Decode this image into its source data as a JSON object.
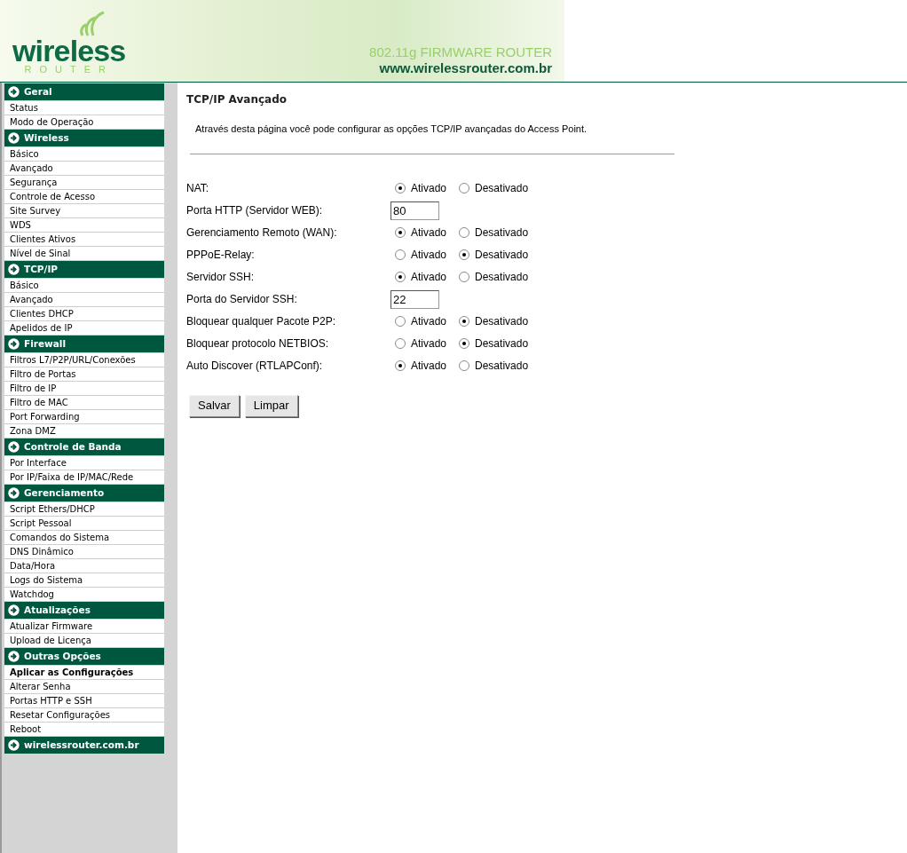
{
  "header": {
    "logo_word": "wireless",
    "logo_sub": "ROUTER",
    "tagline": "802.11g FIRMWARE ROUTER",
    "url": "www.wirelessrouter.com.br"
  },
  "sidebar": {
    "sections": [
      {
        "title": "Geral",
        "items": [
          {
            "label": "Status",
            "bold": false
          },
          {
            "label": "Modo de Operação",
            "bold": false
          }
        ]
      },
      {
        "title": "Wireless",
        "items": [
          {
            "label": "Básico",
            "bold": false
          },
          {
            "label": "Avançado",
            "bold": false
          },
          {
            "label": "Segurança",
            "bold": false
          },
          {
            "label": "Controle de Acesso",
            "bold": false
          },
          {
            "label": "Site Survey",
            "bold": false
          },
          {
            "label": "WDS",
            "bold": false
          },
          {
            "label": "Clientes Ativos",
            "bold": false
          },
          {
            "label": "Nível de Sinal",
            "bold": false
          }
        ]
      },
      {
        "title": "TCP/IP",
        "items": [
          {
            "label": "Básico",
            "bold": false
          },
          {
            "label": "Avançado",
            "bold": false
          },
          {
            "label": "Clientes DHCP",
            "bold": false
          },
          {
            "label": "Apelidos de IP",
            "bold": false
          }
        ]
      },
      {
        "title": "Firewall",
        "items": [
          {
            "label": "Filtros L7/P2P/URL/Conexões",
            "bold": false
          },
          {
            "label": "Filtro de Portas",
            "bold": false
          },
          {
            "label": "Filtro de IP",
            "bold": false
          },
          {
            "label": "Filtro de MAC",
            "bold": false
          },
          {
            "label": "Port Forwarding",
            "bold": false
          },
          {
            "label": "Zona DMZ",
            "bold": false
          }
        ]
      },
      {
        "title": "Controle de Banda",
        "items": [
          {
            "label": "Por Interface",
            "bold": false
          },
          {
            "label": "Por IP/Faixa de IP/MAC/Rede",
            "bold": false
          }
        ]
      },
      {
        "title": "Gerenciamento",
        "items": [
          {
            "label": "Script Ethers/DHCP",
            "bold": false
          },
          {
            "label": "Script Pessoal",
            "bold": false
          },
          {
            "label": "Comandos do Sistema",
            "bold": false
          },
          {
            "label": "DNS Dinâmico",
            "bold": false
          },
          {
            "label": "Data/Hora",
            "bold": false
          },
          {
            "label": "Logs do Sistema",
            "bold": false
          },
          {
            "label": "Watchdog",
            "bold": false
          }
        ]
      },
      {
        "title": "Atualizações",
        "items": [
          {
            "label": "Atualizar Firmware",
            "bold": false
          },
          {
            "label": "Upload de Licença",
            "bold": false
          }
        ]
      },
      {
        "title": "Outras Opções",
        "items": [
          {
            "label": "Aplicar as Configurações",
            "bold": true
          },
          {
            "label": "Alterar Senha",
            "bold": false
          },
          {
            "label": "Portas HTTP e SSH",
            "bold": false
          },
          {
            "label": "Resetar Configurações",
            "bold": false
          },
          {
            "label": "Reboot",
            "bold": false
          }
        ]
      },
      {
        "title": "wirelessrouter.com.br"
      }
    ]
  },
  "page": {
    "title": "TCP/IP Avançado",
    "description": "Através desta página você pode configurar as opções TCP/IP avançadas do Access Point.",
    "rows": [
      {
        "kind": "radio",
        "label": "NAT:",
        "options": [
          {
            "label": "Ativado",
            "selected": true
          },
          {
            "label": "Desativado",
            "selected": false
          }
        ]
      },
      {
        "kind": "text",
        "label": "Porta HTTP (Servidor WEB):",
        "value": "80"
      },
      {
        "kind": "radio",
        "label": "Gerenciamento Remoto (WAN):",
        "options": [
          {
            "label": "Ativado",
            "selected": true
          },
          {
            "label": "Desativado",
            "selected": false
          }
        ]
      },
      {
        "kind": "radio",
        "label": "PPPoE-Relay:",
        "options": [
          {
            "label": "Ativado",
            "selected": false
          },
          {
            "label": "Desativado",
            "selected": true
          }
        ]
      },
      {
        "kind": "radio",
        "label": "Servidor SSH:",
        "options": [
          {
            "label": "Ativado",
            "selected": true
          },
          {
            "label": "Desativado",
            "selected": false
          }
        ]
      },
      {
        "kind": "text",
        "label": "Porta do Servidor SSH:",
        "value": "22"
      },
      {
        "kind": "radio",
        "label": "Bloquear qualquer Pacote P2P:",
        "options": [
          {
            "label": "Ativado",
            "selected": false
          },
          {
            "label": "Desativado",
            "selected": true
          }
        ]
      },
      {
        "kind": "radio",
        "label": "Bloquear protocolo NETBIOS:",
        "options": [
          {
            "label": "Ativado",
            "selected": false
          },
          {
            "label": "Desativado",
            "selected": true
          }
        ]
      },
      {
        "kind": "radio",
        "label": "Auto Discover (RTLAPConf):",
        "options": [
          {
            "label": "Ativado",
            "selected": true
          },
          {
            "label": "Desativado",
            "selected": false
          }
        ]
      }
    ],
    "buttons": [
      "Salvar",
      "Limpar"
    ]
  }
}
